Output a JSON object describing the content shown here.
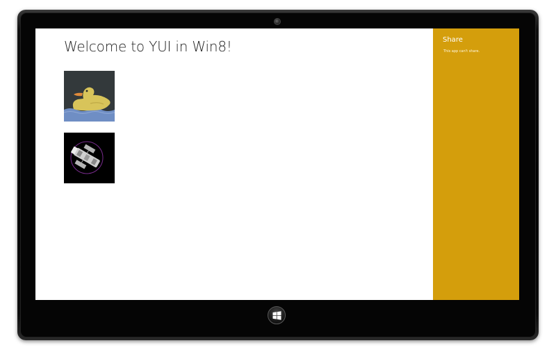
{
  "app": {
    "title": "Welcome to YUI in Win8!"
  },
  "images": [
    {
      "name": "duck-image",
      "subject": "duck"
    },
    {
      "name": "hubble-image",
      "subject": "hubble-telescope"
    }
  ],
  "charm": {
    "title": "Share",
    "message": "This app can't share.",
    "color": "#d49e0c"
  },
  "device": {
    "start_icon": "windows-logo-icon",
    "camera_icon": "camera-icon"
  }
}
